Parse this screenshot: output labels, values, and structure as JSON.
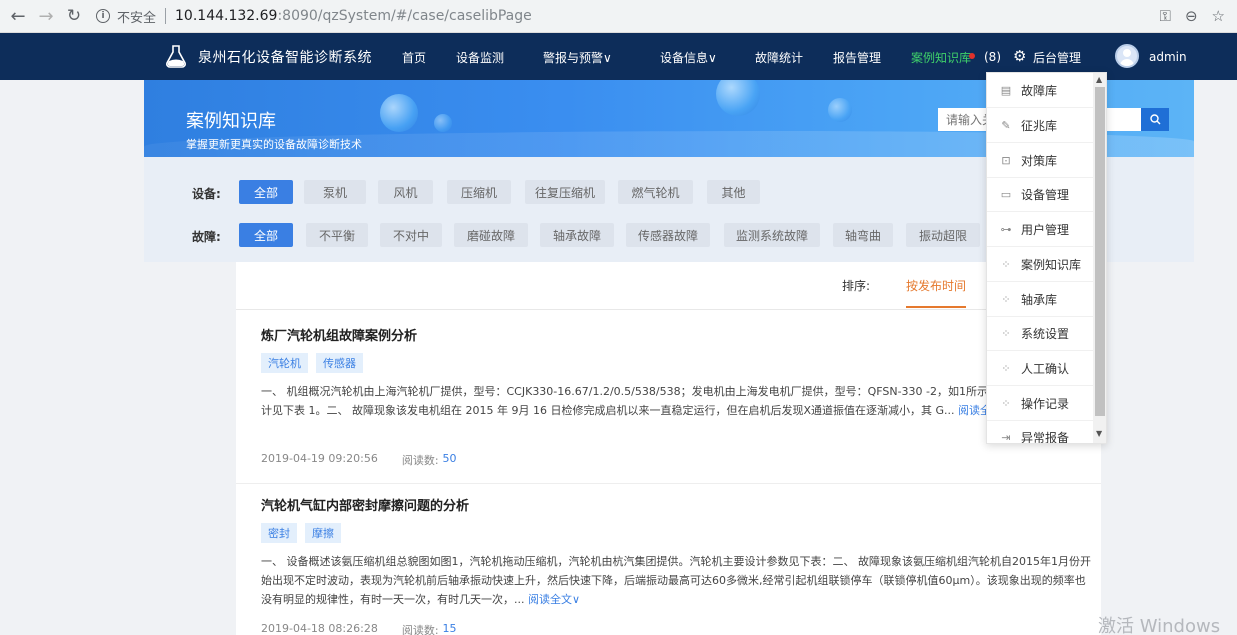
{
  "browser": {
    "insecure_label": "不安全",
    "url_host": "10.144.132.69",
    "url_path": ":8090/qzSystem/#/case/caselibPage"
  },
  "header": {
    "title": "泉州石化设备智能诊断系统",
    "nav": [
      "首页",
      "设备监测",
      "警报与预警",
      "设备信息",
      "故障统计",
      "报告管理",
      "案例知识库"
    ],
    "active_nav": "案例知识库",
    "message_count": "(8)",
    "admin_menu": "后台管理",
    "username": "admin",
    "colors": {
      "bg": "#0d2d5a",
      "active": "#3fd16a"
    }
  },
  "banner": {
    "title": "案例知识库",
    "subtitle": "掌握更新更真实的设备故障诊断技术",
    "search_placeholder": "请输入关键词"
  },
  "filters": {
    "device_label": "设备:",
    "devices": [
      "全部",
      "泵机",
      "风机",
      "压缩机",
      "往复压缩机",
      "燃气轮机",
      "其他"
    ],
    "fault_label": "故障:",
    "faults": [
      "全部",
      "不平衡",
      "不对中",
      "磨碰故障",
      "轴承故障",
      "传感器故障",
      "监测系统故障",
      "轴弯曲",
      "振动超限"
    ]
  },
  "sort": {
    "label": "排序:",
    "active": "按发布时间"
  },
  "articles": [
    {
      "title": "炼厂汽轮机组故障案例分析",
      "tags": [
        "汽轮机",
        "传感器"
      ],
      "body": "一、 机组概况汽轮机由上海汽轮机厂提供，型号：CCJK330-16.67/1.2/0.5/538/538；发电机由上海发电机厂提供，型号：QFSN-330 -2，如1所示：发电机主要参数设计见下表 1。二、 故障现象该发电机组在 2015 年 9月 16 日检修完成启机以来一直稳定运行，但在启机后发现X通道振值在逐渐减小，其 G...",
      "read_more": "阅读全文",
      "date": "2019-04-19 09:20:56",
      "views_label": "阅读数:",
      "views": "50"
    },
    {
      "title": "汽轮机气缸内部密封摩擦问题的分析",
      "tags": [
        "密封",
        "摩擦"
      ],
      "body": "一、 设备概述该氨压缩机组总貌图如图1，汽轮机拖动压缩机，汽轮机由杭汽集团提供。汽轮机主要设计参数见下表：二、 故障现象该氨压缩机组汽轮机自2015年1月份开始出现不定时波动，表现为汽轮机前后轴承振动快速上升，然后快速下降，后端振动最高可达60多微米,经常引起机组联锁停车（联锁停机值60μm）。该现象出现的频率也没有明显的规律性，有时一天一次，有时几天一次，...",
      "read_more": "阅读全文",
      "date": "2019-04-18 08:26:28",
      "views_label": "阅读数:",
      "views": "15"
    }
  ],
  "dropdown": {
    "items": [
      {
        "label": "故障库",
        "icon": "document-icon"
      },
      {
        "label": "征兆库",
        "icon": "edit-icon"
      },
      {
        "label": "对策库",
        "icon": "briefcase-icon"
      },
      {
        "label": "设备管理",
        "icon": "monitor-icon"
      },
      {
        "label": "用户管理",
        "icon": "org-chart-icon"
      },
      {
        "label": "案例知识库",
        "icon": "grid-icon"
      },
      {
        "label": "轴承库",
        "icon": "grid-icon"
      },
      {
        "label": "系统设置",
        "icon": "grid-icon"
      },
      {
        "label": "人工确认",
        "icon": "grid-icon"
      },
      {
        "label": "操作记录",
        "icon": "grid-icon"
      },
      {
        "label": "异常报备",
        "icon": "export-icon"
      }
    ]
  },
  "watermark": "激活 Windows"
}
